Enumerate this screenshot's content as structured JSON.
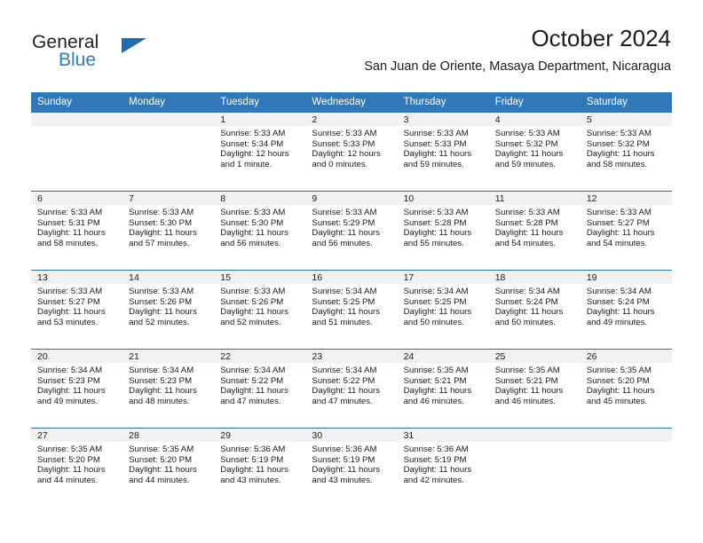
{
  "brand": {
    "name_part1": "General",
    "name_part2": "Blue",
    "logo_icon": "triangle-logo-icon",
    "accent_color": "#2e7ebb"
  },
  "header": {
    "title": "October 2024",
    "location": "San Juan de Oriente, Masaya Department, Nicaragua"
  },
  "theme": {
    "header_blue": "#3178b8",
    "row_divider": "#2f6fa8",
    "daynum_bg": "#f1f1f1"
  },
  "calendar": {
    "weekday_headers": [
      "Sunday",
      "Monday",
      "Tuesday",
      "Wednesday",
      "Thursday",
      "Friday",
      "Saturday"
    ],
    "weeks": [
      [
        {
          "day": "",
          "sunrise": "",
          "sunset": "",
          "daylight1": "",
          "daylight2": ""
        },
        {
          "day": "",
          "sunrise": "",
          "sunset": "",
          "daylight1": "",
          "daylight2": ""
        },
        {
          "day": "1",
          "sunrise": "Sunrise: 5:33 AM",
          "sunset": "Sunset: 5:34 PM",
          "daylight1": "Daylight: 12 hours",
          "daylight2": "and 1 minute."
        },
        {
          "day": "2",
          "sunrise": "Sunrise: 5:33 AM",
          "sunset": "Sunset: 5:33 PM",
          "daylight1": "Daylight: 12 hours",
          "daylight2": "and 0 minutes."
        },
        {
          "day": "3",
          "sunrise": "Sunrise: 5:33 AM",
          "sunset": "Sunset: 5:33 PM",
          "daylight1": "Daylight: 11 hours",
          "daylight2": "and 59 minutes."
        },
        {
          "day": "4",
          "sunrise": "Sunrise: 5:33 AM",
          "sunset": "Sunset: 5:32 PM",
          "daylight1": "Daylight: 11 hours",
          "daylight2": "and 59 minutes."
        },
        {
          "day": "5",
          "sunrise": "Sunrise: 5:33 AM",
          "sunset": "Sunset: 5:32 PM",
          "daylight1": "Daylight: 11 hours",
          "daylight2": "and 58 minutes."
        }
      ],
      [
        {
          "day": "6",
          "sunrise": "Sunrise: 5:33 AM",
          "sunset": "Sunset: 5:31 PM",
          "daylight1": "Daylight: 11 hours",
          "daylight2": "and 58 minutes."
        },
        {
          "day": "7",
          "sunrise": "Sunrise: 5:33 AM",
          "sunset": "Sunset: 5:30 PM",
          "daylight1": "Daylight: 11 hours",
          "daylight2": "and 57 minutes."
        },
        {
          "day": "8",
          "sunrise": "Sunrise: 5:33 AM",
          "sunset": "Sunset: 5:30 PM",
          "daylight1": "Daylight: 11 hours",
          "daylight2": "and 56 minutes."
        },
        {
          "day": "9",
          "sunrise": "Sunrise: 5:33 AM",
          "sunset": "Sunset: 5:29 PM",
          "daylight1": "Daylight: 11 hours",
          "daylight2": "and 56 minutes."
        },
        {
          "day": "10",
          "sunrise": "Sunrise: 5:33 AM",
          "sunset": "Sunset: 5:28 PM",
          "daylight1": "Daylight: 11 hours",
          "daylight2": "and 55 minutes."
        },
        {
          "day": "11",
          "sunrise": "Sunrise: 5:33 AM",
          "sunset": "Sunset: 5:28 PM",
          "daylight1": "Daylight: 11 hours",
          "daylight2": "and 54 minutes."
        },
        {
          "day": "12",
          "sunrise": "Sunrise: 5:33 AM",
          "sunset": "Sunset: 5:27 PM",
          "daylight1": "Daylight: 11 hours",
          "daylight2": "and 54 minutes."
        }
      ],
      [
        {
          "day": "13",
          "sunrise": "Sunrise: 5:33 AM",
          "sunset": "Sunset: 5:27 PM",
          "daylight1": "Daylight: 11 hours",
          "daylight2": "and 53 minutes."
        },
        {
          "day": "14",
          "sunrise": "Sunrise: 5:33 AM",
          "sunset": "Sunset: 5:26 PM",
          "daylight1": "Daylight: 11 hours",
          "daylight2": "and 52 minutes."
        },
        {
          "day": "15",
          "sunrise": "Sunrise: 5:33 AM",
          "sunset": "Sunset: 5:26 PM",
          "daylight1": "Daylight: 11 hours",
          "daylight2": "and 52 minutes."
        },
        {
          "day": "16",
          "sunrise": "Sunrise: 5:34 AM",
          "sunset": "Sunset: 5:25 PM",
          "daylight1": "Daylight: 11 hours",
          "daylight2": "and 51 minutes."
        },
        {
          "day": "17",
          "sunrise": "Sunrise: 5:34 AM",
          "sunset": "Sunset: 5:25 PM",
          "daylight1": "Daylight: 11 hours",
          "daylight2": "and 50 minutes."
        },
        {
          "day": "18",
          "sunrise": "Sunrise: 5:34 AM",
          "sunset": "Sunset: 5:24 PM",
          "daylight1": "Daylight: 11 hours",
          "daylight2": "and 50 minutes."
        },
        {
          "day": "19",
          "sunrise": "Sunrise: 5:34 AM",
          "sunset": "Sunset: 5:24 PM",
          "daylight1": "Daylight: 11 hours",
          "daylight2": "and 49 minutes."
        }
      ],
      [
        {
          "day": "20",
          "sunrise": "Sunrise: 5:34 AM",
          "sunset": "Sunset: 5:23 PM",
          "daylight1": "Daylight: 11 hours",
          "daylight2": "and 49 minutes."
        },
        {
          "day": "21",
          "sunrise": "Sunrise: 5:34 AM",
          "sunset": "Sunset: 5:23 PM",
          "daylight1": "Daylight: 11 hours",
          "daylight2": "and 48 minutes."
        },
        {
          "day": "22",
          "sunrise": "Sunrise: 5:34 AM",
          "sunset": "Sunset: 5:22 PM",
          "daylight1": "Daylight: 11 hours",
          "daylight2": "and 47 minutes."
        },
        {
          "day": "23",
          "sunrise": "Sunrise: 5:34 AM",
          "sunset": "Sunset: 5:22 PM",
          "daylight1": "Daylight: 11 hours",
          "daylight2": "and 47 minutes."
        },
        {
          "day": "24",
          "sunrise": "Sunrise: 5:35 AM",
          "sunset": "Sunset: 5:21 PM",
          "daylight1": "Daylight: 11 hours",
          "daylight2": "and 46 minutes."
        },
        {
          "day": "25",
          "sunrise": "Sunrise: 5:35 AM",
          "sunset": "Sunset: 5:21 PM",
          "daylight1": "Daylight: 11 hours",
          "daylight2": "and 46 minutes."
        },
        {
          "day": "26",
          "sunrise": "Sunrise: 5:35 AM",
          "sunset": "Sunset: 5:20 PM",
          "daylight1": "Daylight: 11 hours",
          "daylight2": "and 45 minutes."
        }
      ],
      [
        {
          "day": "27",
          "sunrise": "Sunrise: 5:35 AM",
          "sunset": "Sunset: 5:20 PM",
          "daylight1": "Daylight: 11 hours",
          "daylight2": "and 44 minutes."
        },
        {
          "day": "28",
          "sunrise": "Sunrise: 5:35 AM",
          "sunset": "Sunset: 5:20 PM",
          "daylight1": "Daylight: 11 hours",
          "daylight2": "and 44 minutes."
        },
        {
          "day": "29",
          "sunrise": "Sunrise: 5:36 AM",
          "sunset": "Sunset: 5:19 PM",
          "daylight1": "Daylight: 11 hours",
          "daylight2": "and 43 minutes."
        },
        {
          "day": "30",
          "sunrise": "Sunrise: 5:36 AM",
          "sunset": "Sunset: 5:19 PM",
          "daylight1": "Daylight: 11 hours",
          "daylight2": "and 43 minutes."
        },
        {
          "day": "31",
          "sunrise": "Sunrise: 5:36 AM",
          "sunset": "Sunset: 5:19 PM",
          "daylight1": "Daylight: 11 hours",
          "daylight2": "and 42 minutes."
        },
        {
          "day": "",
          "sunrise": "",
          "sunset": "",
          "daylight1": "",
          "daylight2": ""
        },
        {
          "day": "",
          "sunrise": "",
          "sunset": "",
          "daylight1": "",
          "daylight2": ""
        }
      ]
    ]
  }
}
